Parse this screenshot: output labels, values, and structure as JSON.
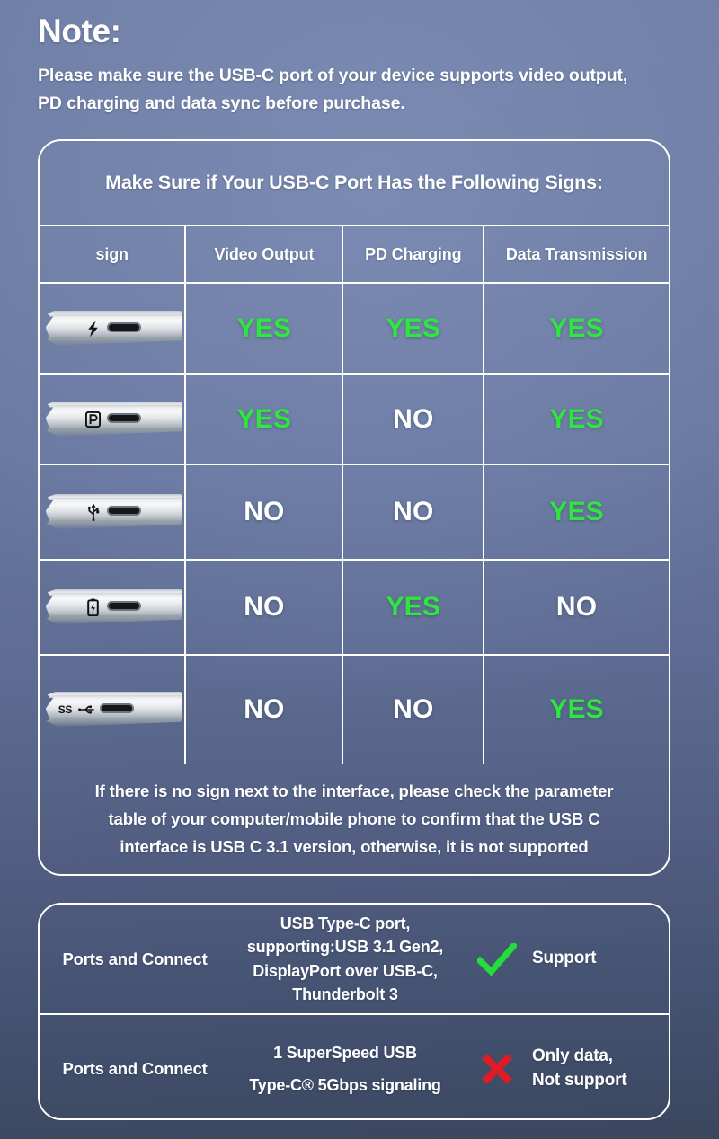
{
  "note": {
    "title": "Note:",
    "line1": "Please make sure the USB-C port of your device supports video output,",
    "line2": "PD charging and data sync before purchase."
  },
  "signs_card": {
    "heading": "Make Sure if Your USB-C Port Has the Following Signs:",
    "columns": [
      "sign",
      "Video Output",
      "PD Charging",
      "Data Transmission"
    ],
    "rows": [
      {
        "sign_icon": "thunderbolt-bolt-icon",
        "sign_glyph": "⚡",
        "video": "YES",
        "pd": "YES",
        "data": "YES"
      },
      {
        "sign_icon": "displayport-p-icon",
        "sign_glyph": "P",
        "video": "YES",
        "pd": "NO",
        "data": "YES"
      },
      {
        "sign_icon": "usb-trident-icon",
        "sign_glyph": "⑂",
        "video": "NO",
        "pd": "NO",
        "data": "YES"
      },
      {
        "sign_icon": "battery-icon",
        "sign_glyph": "▯",
        "video": "NO",
        "pd": "YES",
        "data": "NO"
      },
      {
        "sign_icon": "superspeed-usb-icon",
        "sign_glyph": "SS",
        "video": "NO",
        "pd": "NO",
        "data": "YES"
      }
    ],
    "footer_lines": [
      "If there is no sign next to the interface, please check the parameter",
      "table of your computer/mobile phone to confirm that the USB C",
      "interface is USB C 3.1 version, otherwise, it is not supported"
    ]
  },
  "ports_card": {
    "rows": [
      {
        "label": "Ports and Connect",
        "description_lines": [
          "USB Type-C port,",
          "supporting:USB 3.1 Gen2,",
          "DisplayPort over USB-C,",
          "Thunderbolt 3"
        ],
        "mark_icon": "green-check-icon",
        "verdict_lines": [
          "Support"
        ]
      },
      {
        "label": "Ports and Connect",
        "description_lines": [
          "1 SuperSpeed USB",
          "Type-C® 5Gbps signaling"
        ],
        "mark_icon": "red-cross-icon",
        "verdict_lines": [
          "Only data,",
          "Not support"
        ]
      }
    ]
  },
  "colors": {
    "yes_green": "#2fe53f",
    "no_white": "#ffffff",
    "check_green": "#22dd3a",
    "cross_red": "#e01b24",
    "background_top": "#6e7da4",
    "background_bottom": "#3a475e"
  }
}
